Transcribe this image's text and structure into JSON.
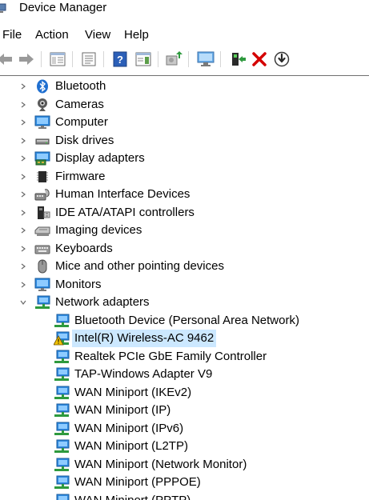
{
  "window": {
    "title": "Device Manager"
  },
  "menu": {
    "items": [
      "File",
      "Action",
      "View",
      "Help"
    ]
  },
  "toolbar": {
    "buttons": [
      "back-arrow-icon",
      "forward-arrow-icon",
      "show-hide-console-tree-icon",
      "properties-icon",
      "help-icon",
      "action-pane-icon",
      "update-driver-icon",
      "scan-hardware-icon",
      "enable-device-icon",
      "uninstall-device-icon",
      "disable-device-icon"
    ]
  },
  "tree": {
    "categories": [
      {
        "label": "Bluetooth",
        "icon": "bluetooth-icon",
        "expanded": false
      },
      {
        "label": "Cameras",
        "icon": "camera-icon",
        "expanded": false
      },
      {
        "label": "Computer",
        "icon": "computer-icon",
        "expanded": false
      },
      {
        "label": "Disk drives",
        "icon": "disk-drive-icon",
        "expanded": false
      },
      {
        "label": "Display adapters",
        "icon": "display-adapter-icon",
        "expanded": false
      },
      {
        "label": "Firmware",
        "icon": "firmware-icon",
        "expanded": false
      },
      {
        "label": "Human Interface Devices",
        "icon": "hid-icon",
        "expanded": false
      },
      {
        "label": "IDE ATA/ATAPI controllers",
        "icon": "ide-controller-icon",
        "expanded": false
      },
      {
        "label": "Imaging devices",
        "icon": "imaging-device-icon",
        "expanded": false
      },
      {
        "label": "Keyboards",
        "icon": "keyboard-icon",
        "expanded": false
      },
      {
        "label": "Mice and other pointing devices",
        "icon": "mouse-icon",
        "expanded": false
      },
      {
        "label": "Monitors",
        "icon": "monitor-icon",
        "expanded": false
      },
      {
        "label": "Network adapters",
        "icon": "network-adapter-icon",
        "expanded": true
      }
    ],
    "network_devices": [
      {
        "label": "Bluetooth Device (Personal Area Network)",
        "warning": false,
        "selected": false
      },
      {
        "label": "Intel(R) Wireless-AC 9462",
        "warning": true,
        "selected": true
      },
      {
        "label": "Realtek PCIe GbE Family Controller",
        "warning": false,
        "selected": false
      },
      {
        "label": "TAP-Windows Adapter V9",
        "warning": false,
        "selected": false
      },
      {
        "label": "WAN Miniport (IKEv2)",
        "warning": false,
        "selected": false
      },
      {
        "label": "WAN Miniport (IP)",
        "warning": false,
        "selected": false
      },
      {
        "label": "WAN Miniport (IPv6)",
        "warning": false,
        "selected": false
      },
      {
        "label": "WAN Miniport (L2TP)",
        "warning": false,
        "selected": false
      },
      {
        "label": "WAN Miniport (Network Monitor)",
        "warning": false,
        "selected": false
      },
      {
        "label": "WAN Miniport (PPPOE)",
        "warning": false,
        "selected": false
      },
      {
        "label": "WAN Miniport (PPTP)",
        "warning": false,
        "selected": false
      }
    ]
  },
  "colors": {
    "selection": "#cce8ff",
    "adapter_blue": "#2f8ae0",
    "adapter_green": "#2e9a3e",
    "warning_yellow": "#f2c200",
    "delete_red": "#d40000"
  }
}
